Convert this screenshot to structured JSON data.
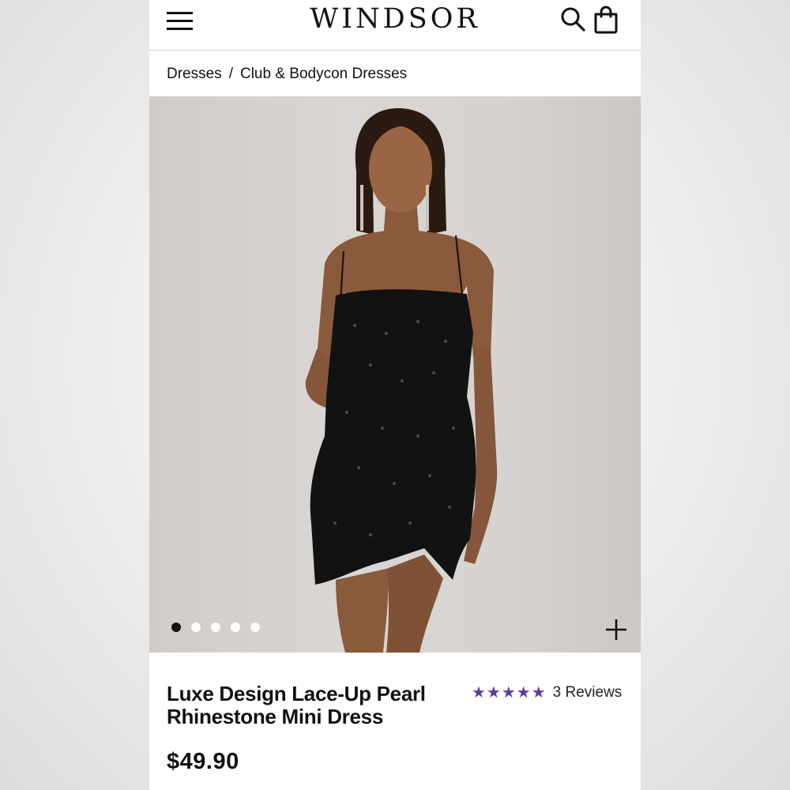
{
  "header": {
    "logo": "WINDSOR",
    "menu_icon": "hamburger-menu-icon",
    "search_icon": "search-icon",
    "bag_icon": "shopping-bag-icon"
  },
  "breadcrumb": {
    "items": [
      "Dresses",
      "Club & Bodycon Dresses"
    ],
    "separator": "/"
  },
  "gallery": {
    "image_count": 5,
    "active_index": 0,
    "zoom_icon": "plus-icon"
  },
  "product": {
    "title_line1": "Luxe Design Lace-Up Pearl",
    "title_line2": "Rhinestone Mini Dress",
    "rating": 5,
    "stars": "★★★★★",
    "reviews": "3 Reviews",
    "price": "$49.90"
  },
  "colors": {
    "star": "#5b3ea0",
    "text": "#111111"
  }
}
